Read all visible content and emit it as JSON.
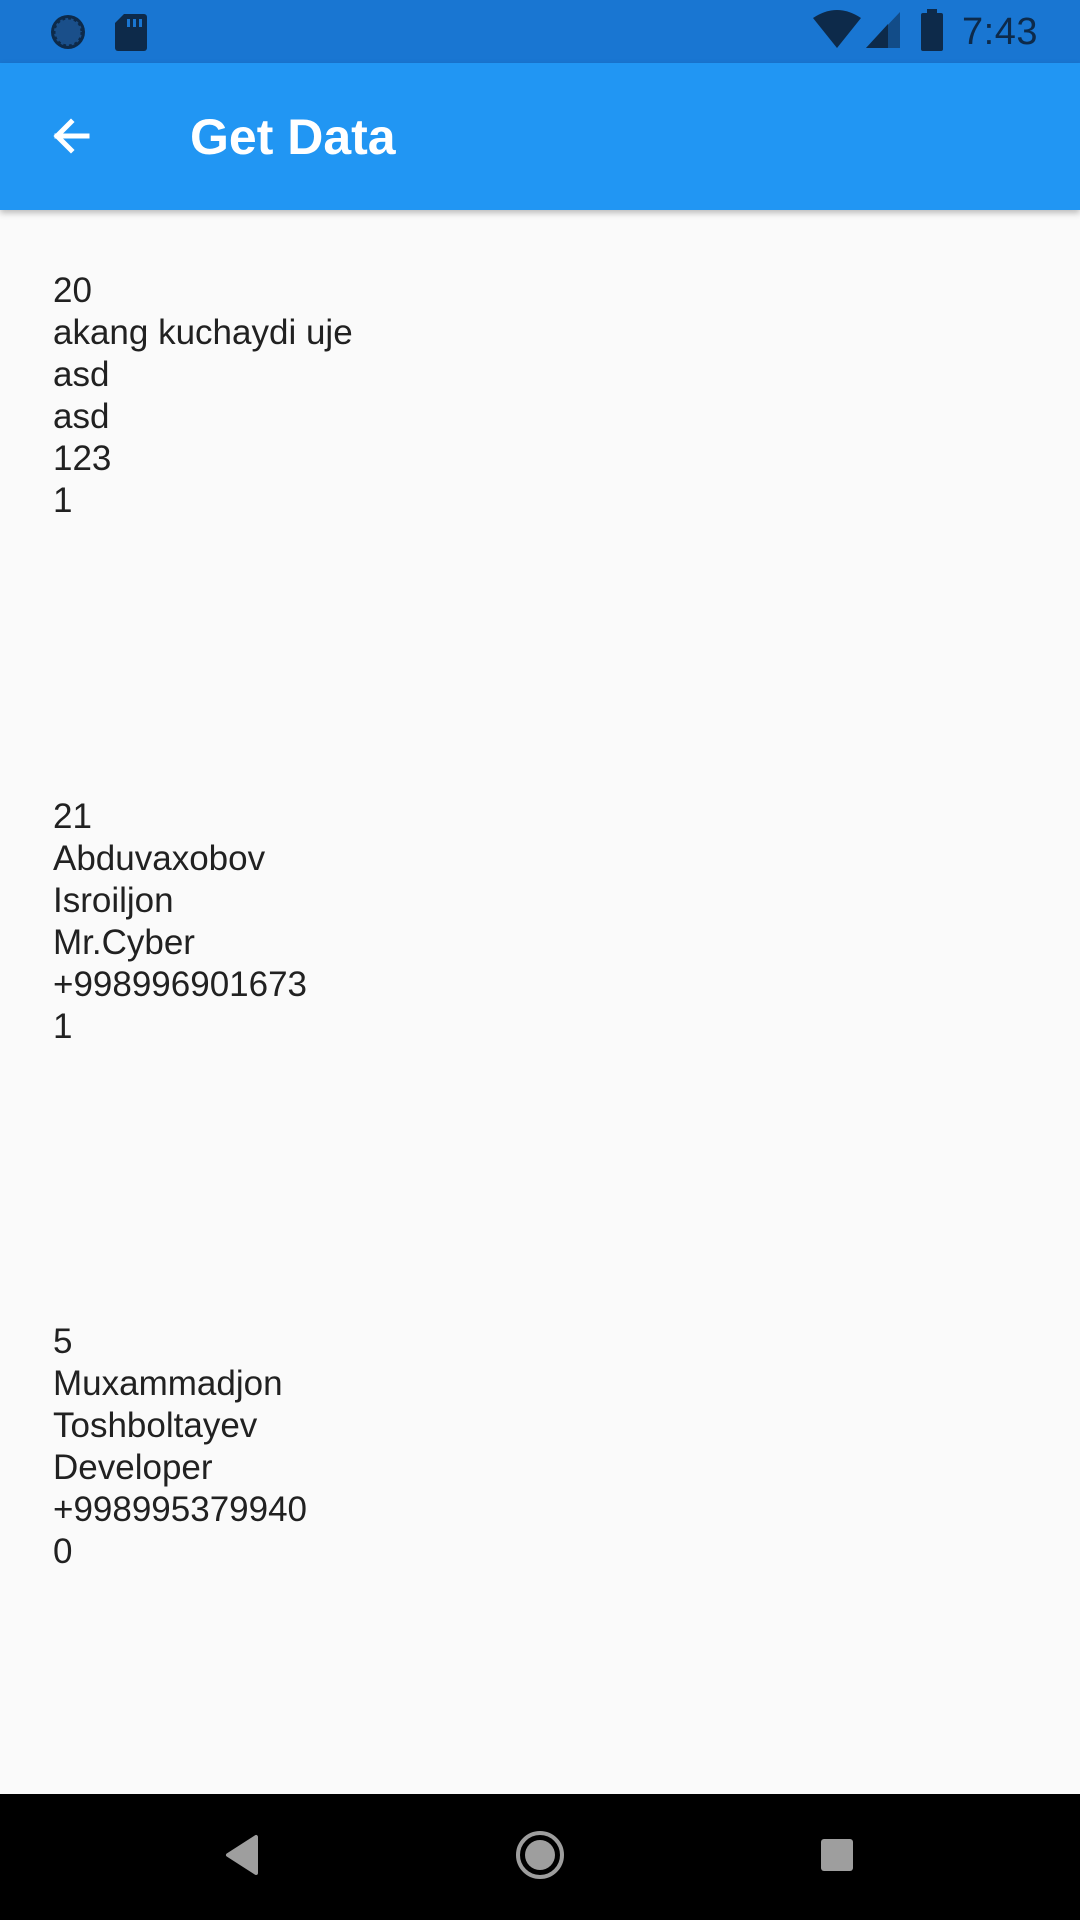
{
  "status_bar": {
    "time": "7:43",
    "left_icons": [
      "circle-notification-icon",
      "sd-card-icon"
    ],
    "right_icons": [
      "wifi-icon",
      "cell-signal-icon",
      "battery-icon"
    ]
  },
  "app_bar": {
    "title": "Get Data",
    "back_icon": "arrow-back-icon",
    "color": "#2196f3"
  },
  "records": [
    {
      "id": "20",
      "last_name": "akang kuchaydi uje",
      "first_name": "asd",
      "job": "asd",
      "phone": "123",
      "flag": "1"
    },
    {
      "id": "21",
      "last_name": "Abduvaxobov",
      "first_name": "Isroiljon",
      "job": "Mr.Cyber",
      "phone": "+998996901673",
      "flag": "1"
    },
    {
      "id": "5",
      "last_name": "Muxammadjon",
      "first_name": "Toshboltayev",
      "job": "Developer",
      "phone": "+998995379940",
      "flag": "0"
    }
  ],
  "nav_bar": {
    "buttons": [
      "back-triangle-icon",
      "home-circle-icon",
      "recents-square-icon"
    ]
  }
}
